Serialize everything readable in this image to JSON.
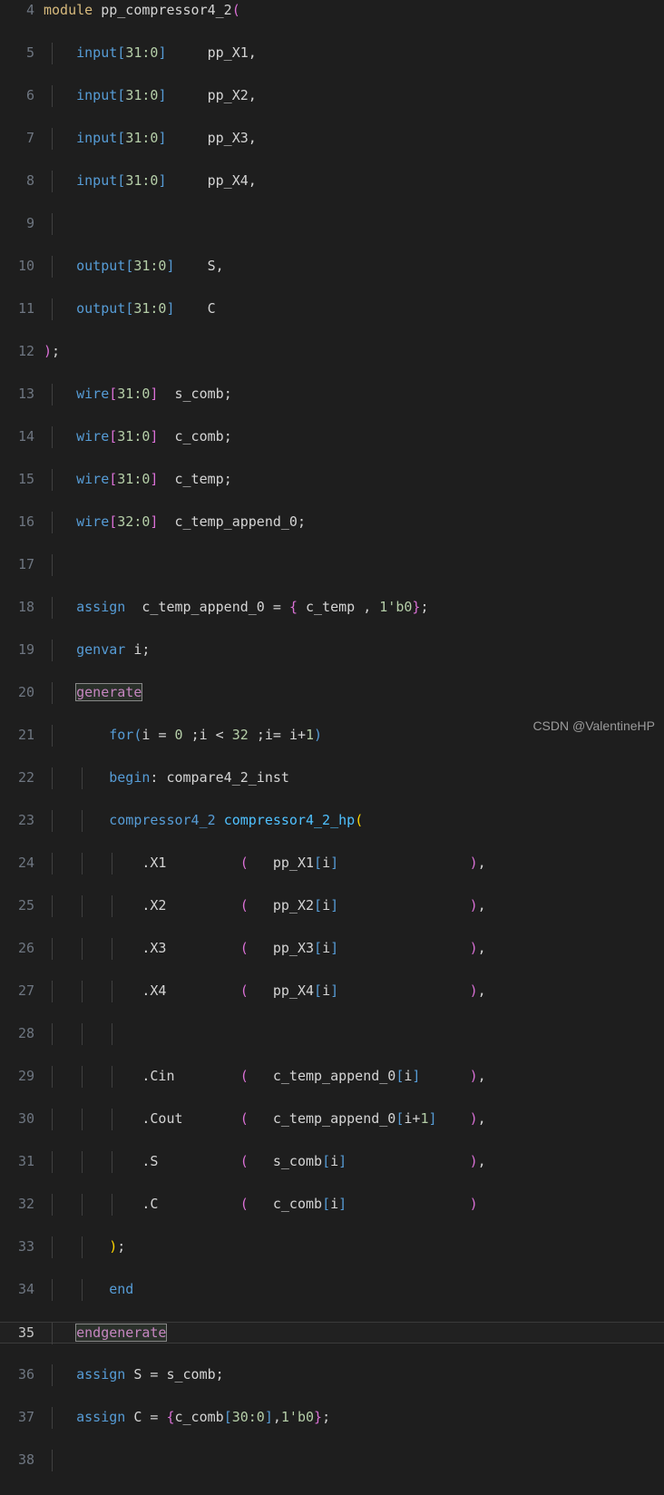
{
  "editor": {
    "language": "verilog",
    "theme": "dark-plus",
    "background_color": "#1e1e1e",
    "foreground_color": "#d4d4d4",
    "active_line_background": "#212121",
    "gutter_color": "#6e7681",
    "gutter_active_color": "#c6c6c6",
    "active_line_number": 35,
    "first_visible_line": 4,
    "last_visible_line": 38,
    "colors": {
      "keyword_blue": "#569cd6",
      "keyword_gold": "#d7ba7d",
      "keyword_pink": "#c586c0",
      "identifier": "#d4d4d4",
      "number": "#b5cea8",
      "bracket_magenta": "#da70d6",
      "bracket_blue": "#569cd6",
      "bracket_gold": "#ffd700",
      "signal_lightblue": "#4fc1ff",
      "port_lightblue": "#9cdcfe"
    }
  },
  "watermark": {
    "text": "CSDN @ValentineHP"
  },
  "lines": [
    {
      "number": "4",
      "text": "module pp_compressor4_2("
    },
    {
      "number": "5",
      "text": "    input[31:0]     pp_X1,"
    },
    {
      "number": "6",
      "text": "    input[31:0]     pp_X2,"
    },
    {
      "number": "7",
      "text": "    input[31:0]     pp_X3,"
    },
    {
      "number": "8",
      "text": "    input[31:0]     pp_X4,"
    },
    {
      "number": "9",
      "text": ""
    },
    {
      "number": "10",
      "text": "    output[31:0]    S,"
    },
    {
      "number": "11",
      "text": "    output[31:0]    C"
    },
    {
      "number": "12",
      "text": ");"
    },
    {
      "number": "13",
      "text": "    wire[31:0]  s_comb;"
    },
    {
      "number": "14",
      "text": "    wire[31:0]  c_comb;"
    },
    {
      "number": "15",
      "text": "    wire[31:0]  c_temp;"
    },
    {
      "number": "16",
      "text": "    wire[32:0]  c_temp_append_0;"
    },
    {
      "number": "17",
      "text": ""
    },
    {
      "number": "18",
      "text": "    assign  c_temp_append_0 = { c_temp , 1'b0};"
    },
    {
      "number": "19",
      "text": "    genvar i;"
    },
    {
      "number": "20",
      "text": "    generate"
    },
    {
      "number": "21",
      "text": "        for(i = 0 ;i < 32 ;i= i+1)"
    },
    {
      "number": "22",
      "text": "        begin: compare4_2_inst"
    },
    {
      "number": "23",
      "text": "        compressor4_2 compressor4_2_hp("
    },
    {
      "number": "24",
      "text": "            .X1         (   pp_X1[i]                ),"
    },
    {
      "number": "25",
      "text": "            .X2         (   pp_X2[i]                ),"
    },
    {
      "number": "26",
      "text": "            .X3         (   pp_X3[i]                ),"
    },
    {
      "number": "27",
      "text": "            .X4         (   pp_X4[i]                ),"
    },
    {
      "number": "28",
      "text": ""
    },
    {
      "number": "29",
      "text": "            .Cin        (   c_temp_append_0[i]      ),"
    },
    {
      "number": "30",
      "text": "            .Cout       (   c_temp_append_0[i+1]    ),"
    },
    {
      "number": "31",
      "text": "            .S          (   s_comb[i]               ),"
    },
    {
      "number": "32",
      "text": "            .C          (   c_comb[i]               )"
    },
    {
      "number": "33",
      "text": "        );"
    },
    {
      "number": "34",
      "text": "        end"
    },
    {
      "number": "35",
      "text": "    endgenerate"
    },
    {
      "number": "36",
      "text": "    assign S = s_comb;"
    },
    {
      "number": "37",
      "text": "    assign C = {c_comb[30:0],1'b0};"
    },
    {
      "number": "38",
      "text": ""
    }
  ],
  "tokens": {
    "module": "module",
    "module_name": "pp_compressor4_2",
    "input": "input",
    "output": "output",
    "wire": "wire",
    "assign": "assign",
    "genvar": "genvar",
    "generate": "generate",
    "endgenerate": "endgenerate",
    "for": "for",
    "begin": "begin",
    "end": "end",
    "range_31_0": "31:0",
    "range_32_0": "32:0",
    "range_30_0": "30:0",
    "signal_pp_X1": "pp_X1",
    "signal_pp_X2": "pp_X2",
    "signal_pp_X3": "pp_X3",
    "signal_pp_X4": "pp_X4",
    "signal_S": "S",
    "signal_C": "C",
    "signal_s_comb": "s_comb",
    "signal_c_comb": "c_comb",
    "signal_c_temp": "c_temp",
    "signal_c_temp_append_0": "c_temp_append_0",
    "literal_1b0": "1'b0",
    "loop_var": "i",
    "loop_limit": "32",
    "loop_start": "0",
    "block_label": "compare4_2_inst",
    "module_type": "compressor4_2",
    "instance_name": "compressor4_2_hp",
    "port_X1": ".X1",
    "port_X2": ".X2",
    "port_X3": ".X3",
    "port_X4": ".X4",
    "port_Cin": ".Cin",
    "port_Cout": ".Cout",
    "port_S": ".S",
    "port_C": ".C"
  }
}
